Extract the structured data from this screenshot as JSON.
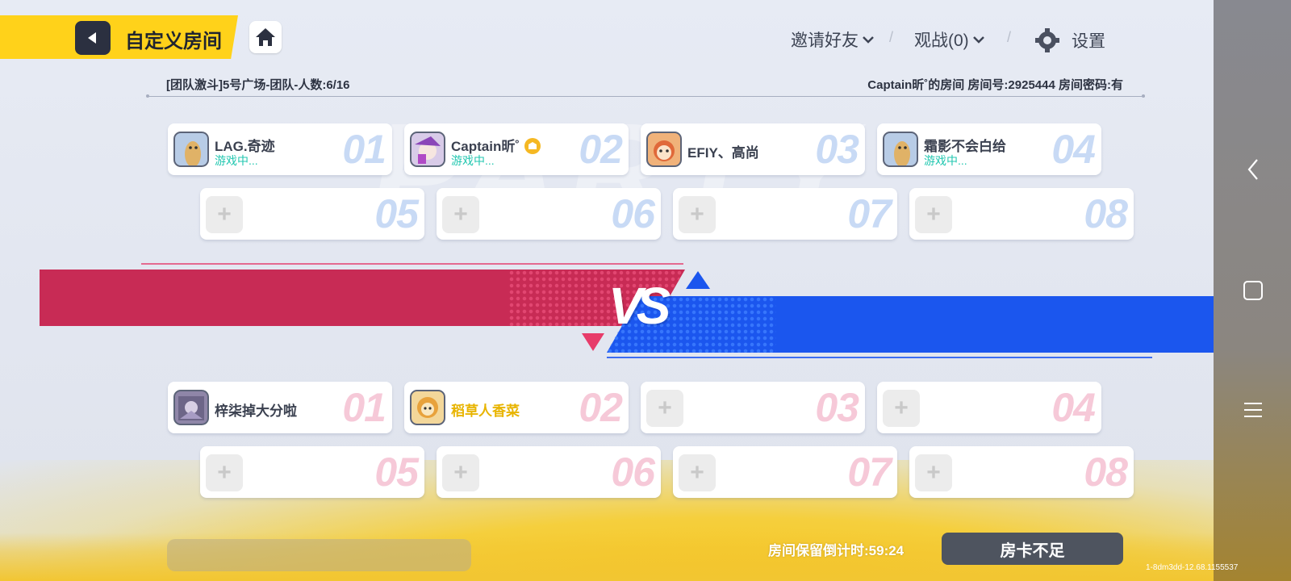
{
  "header": {
    "title": "自定义房间",
    "invite_label": "邀请好友",
    "spectate_label": "观战(0)",
    "settings_label": "设置",
    "separator": "/"
  },
  "room_info": {
    "left": "[团队激斗]5号广场-团队-人数:6/16",
    "right": "Captain昕˚的房间 房间号:2925444 房间密码:有"
  },
  "team_blue": {
    "slots": [
      {
        "num": "01",
        "name": "LAG.奇迹",
        "status": "游戏中..."
      },
      {
        "num": "02",
        "name": "Captain昕˚",
        "status": "游戏中...",
        "host": true
      },
      {
        "num": "03",
        "name": "EFIY、高尚",
        "status": ""
      },
      {
        "num": "04",
        "name": "霜影不会白给",
        "status": "游戏中..."
      },
      {
        "num": "05",
        "add": "+"
      },
      {
        "num": "06",
        "add": "+"
      },
      {
        "num": "07",
        "add": "+"
      },
      {
        "num": "08",
        "add": "+"
      }
    ]
  },
  "vs_label": "VS",
  "team_red": {
    "slots": [
      {
        "num": "01",
        "name": "梓柒掉大分啦",
        "status": ""
      },
      {
        "num": "02",
        "name": "稻草人香菜",
        "status": ""
      },
      {
        "num": "03",
        "add": "+"
      },
      {
        "num": "04",
        "add": "+"
      },
      {
        "num": "05",
        "add": "+"
      },
      {
        "num": "06",
        "add": "+"
      },
      {
        "num": "07",
        "add": "+"
      },
      {
        "num": "08",
        "add": "+"
      }
    ]
  },
  "footer": {
    "countdown": "房间保留倒计时:59:24",
    "room_card_button": "房卡不足",
    "version": "1-8dm3dd-12.68.1155537"
  },
  "colors": {
    "accent_yellow": "#ffd21a",
    "team_red": "#c82b55",
    "team_blue": "#1b56ee",
    "status_green": "#22c7b0",
    "special_name_gold": "#e8b400"
  },
  "icons": [
    "back-arrow-icon",
    "home-icon",
    "chevron-down-icon",
    "gear-icon",
    "crown-icon",
    "plus-icon",
    "nav-back-icon",
    "nav-home-icon",
    "nav-menu-icon"
  ]
}
